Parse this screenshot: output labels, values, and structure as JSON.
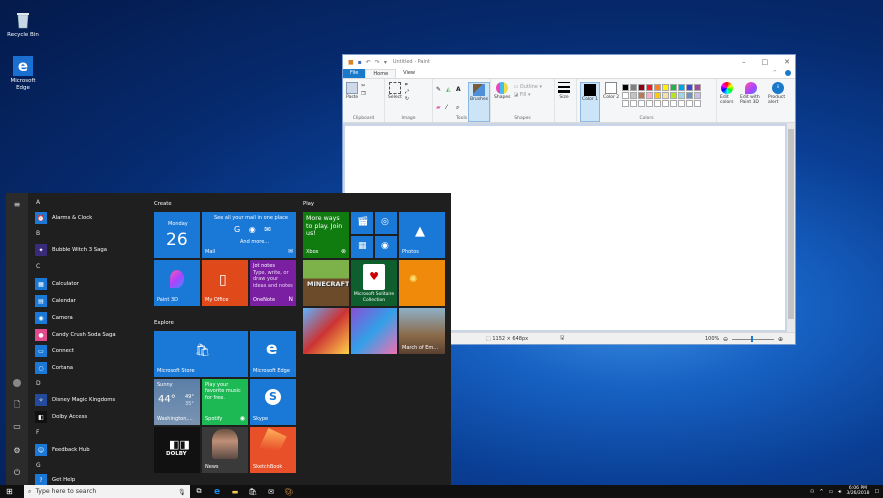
{
  "desktop": {
    "recycle_bin": "Recycle Bin",
    "edge_line1": "Microsoft",
    "edge_line2": "Edge"
  },
  "paint": {
    "title": "Untitled - Paint",
    "tabs": {
      "file": "File",
      "home": "Home",
      "view": "View"
    },
    "ribbon": {
      "paste": "Paste",
      "select": "Select",
      "brushes": "Brushes",
      "shapes": "Shapes",
      "outline": "Outline",
      "fill": "Fill",
      "size": "Size",
      "color1": "Color 1",
      "color2": "Color 2",
      "edit_colors": "Edit colors",
      "edit_paint3d": "Edit with Paint 3D",
      "product_alert": "Product alert",
      "groups": {
        "clipboard": "Clipboard",
        "image": "Image",
        "tools": "Tools",
        "shapes": "Shapes",
        "colors": "Colors"
      }
    },
    "status": {
      "dimensions": "1152 × 648px",
      "zoom": "100%"
    },
    "palette": [
      "#000000",
      "#7f7f7f",
      "#880015",
      "#ed1c24",
      "#ff7f27",
      "#fff200",
      "#22b14c",
      "#00a2e8",
      "#3f48cc",
      "#a349a4",
      "#ffffff",
      "#c3c3c3",
      "#b97a57",
      "#ffaec9",
      "#ffc90e",
      "#efe4b0",
      "#b5e61d",
      "#99d9ea",
      "#7092be",
      "#c8bfe7",
      "#ffffff",
      "#ffffff",
      "#ffffff",
      "#ffffff",
      "#ffffff",
      "#ffffff",
      "#ffffff",
      "#ffffff",
      "#ffffff",
      "#ffffff"
    ]
  },
  "start": {
    "letters": {
      "a": "A",
      "b": "B",
      "c": "C",
      "d": "D",
      "f": "F",
      "g": "G"
    },
    "apps": {
      "alarms": "Alarms & Clock",
      "bubble": "Bubble Witch 3 Saga",
      "calculator": "Calculator",
      "calendar": "Calendar",
      "camera": "Camera",
      "candy": "Candy Crush Soda Saga",
      "connect": "Connect",
      "cortana": "Cortana",
      "disney": "Disney Magic Kingdoms",
      "dolby": "Dolby Access",
      "feedback": "Feedback Hub",
      "gethelp": "Get Help"
    },
    "groups": {
      "create": "Create",
      "play": "Play",
      "explore": "Explore"
    },
    "tiles": {
      "calendar_day": "Monday",
      "calendar_date": "26",
      "mail_text": "See all your mail in one place",
      "mail_more": "And more...",
      "mail": "Mail",
      "paint3d": "Paint 3D",
      "myoffice": "My Office",
      "onenote_title": "Jot notes",
      "onenote_text": "Type, write, or draw your ideas and notes",
      "onenote": "OneNote",
      "xbox_text": "More ways to play. Join us!",
      "xbox": "Xbox",
      "photos": "Photos",
      "minecraft": "MINECRAFT",
      "solitaire": "Microsoft Solitaire Collection",
      "march": "March of Em...",
      "store": "Microsoft Store",
      "edge": "Microsoft Edge",
      "weather_cond": "Sunny",
      "weather_temp": "44°",
      "weather_hi": "49°",
      "weather_lo": "35°",
      "weather_city": "Washington,...",
      "spotify_text": "Play your favorite music for free.",
      "spotify": "Spotify",
      "skype": "Skype",
      "dolby": "DOLBY",
      "news": "News",
      "sketchbook": "SketchBook"
    }
  },
  "taskbar": {
    "search_placeholder": "Type here to search",
    "time": "6:06 PM",
    "date": "3/26/2018"
  }
}
